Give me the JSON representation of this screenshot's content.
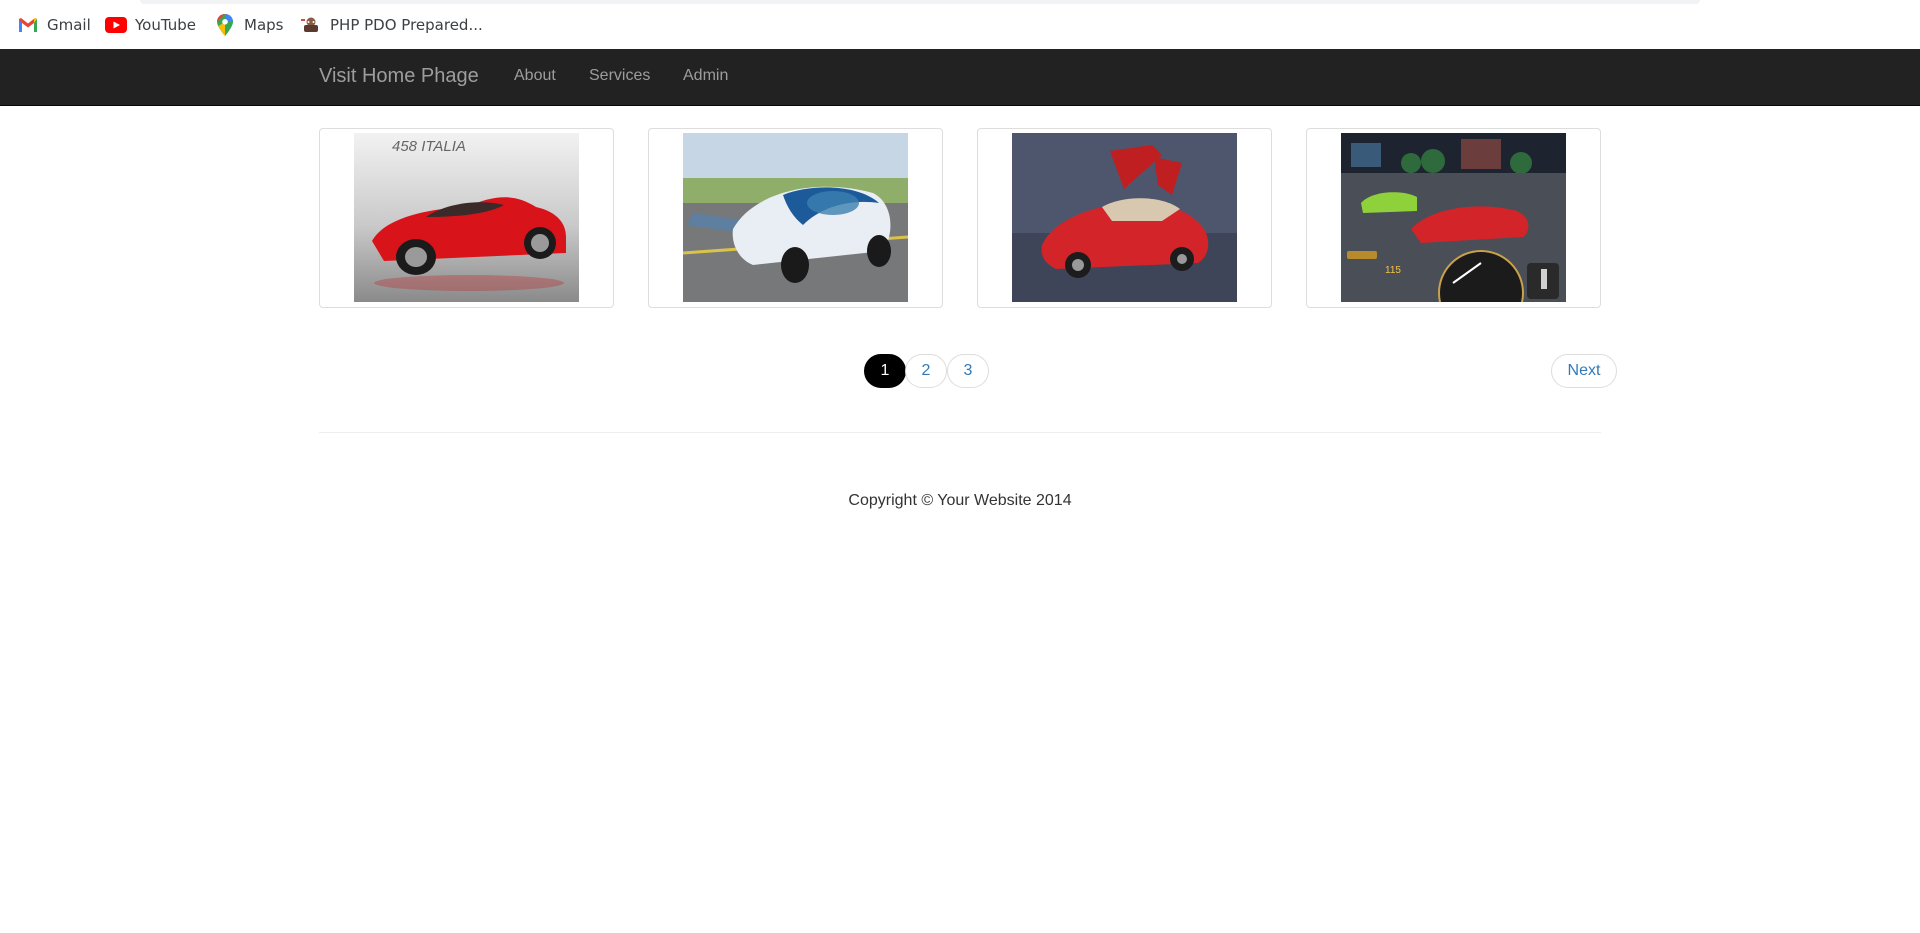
{
  "bookmarks": [
    {
      "label": "Gmail",
      "icon": "gmail-icon"
    },
    {
      "label": "YouTube",
      "icon": "youtube-icon"
    },
    {
      "label": "Maps",
      "icon": "maps-icon"
    },
    {
      "label": "PHP PDO Prepared...",
      "icon": "php-favicon-icon"
    }
  ],
  "navbar": {
    "brand": "Visit Home Phage",
    "links": [
      "About",
      "Services",
      "Admin"
    ],
    "background": "#222222",
    "text_color": "#9d9d9d"
  },
  "gallery": [
    {
      "description": "red Ferrari 458 Italia",
      "overlay_text": "458 ITALIA"
    },
    {
      "description": "blue and white flying car"
    },
    {
      "description": "red concept car with gull-wing doors"
    },
    {
      "description": "racing game screenshot with red sports car",
      "overlay_text": "115"
    }
  ],
  "pagination": {
    "pages": [
      "1",
      "2",
      "3"
    ],
    "active_page": "1",
    "next_label": "Next",
    "link_color": "#337ab7"
  },
  "footer": {
    "copyright": "Copyright © Your Website 2014"
  }
}
